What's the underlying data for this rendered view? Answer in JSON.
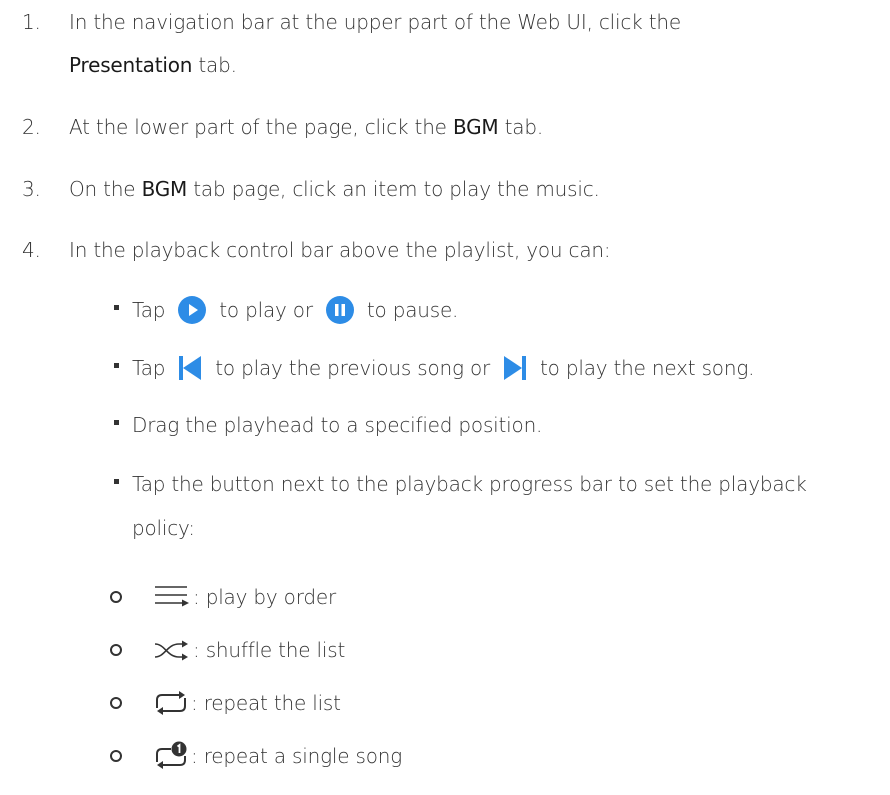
{
  "steps": [
    {
      "num": "1.",
      "line1_pre": "In the navigation bar at the upper part of the Web UI, click the",
      "line2_bold": "Presentation",
      "line2_post": " tab."
    },
    {
      "num": "2.",
      "pre": "At the lower part of the page, click the ",
      "bold": "BGM",
      "post": " tab."
    },
    {
      "num": "3.",
      "pre": "On the ",
      "bold": "BGM",
      "post": " tab page, click an item to play the music."
    },
    {
      "num": "4.",
      "text": "In the playback control bar above the playlist, you can:"
    }
  ],
  "bullets": {
    "play": {
      "pre": "Tap",
      "mid": "to play or",
      "post": "to pause."
    },
    "skip": {
      "pre": "Tap",
      "mid": "to play the previous song or",
      "post": "to play the next song."
    },
    "drag": "Drag the playhead to a specified position.",
    "policy_line1": "Tap the button next to the playback progress bar to set the playback",
    "policy_line2": "policy:"
  },
  "policies": [
    {
      "icon": "play-by-order-icon",
      "text": ": play by order"
    },
    {
      "icon": "shuffle-icon",
      "text": ": shuffle the list"
    },
    {
      "icon": "repeat-list-icon",
      "text": ": repeat the list"
    },
    {
      "icon": "repeat-single-icon",
      "text": ": repeat a single song"
    }
  ],
  "colors": {
    "accent": "#2d8ce6",
    "text": "#333333"
  }
}
